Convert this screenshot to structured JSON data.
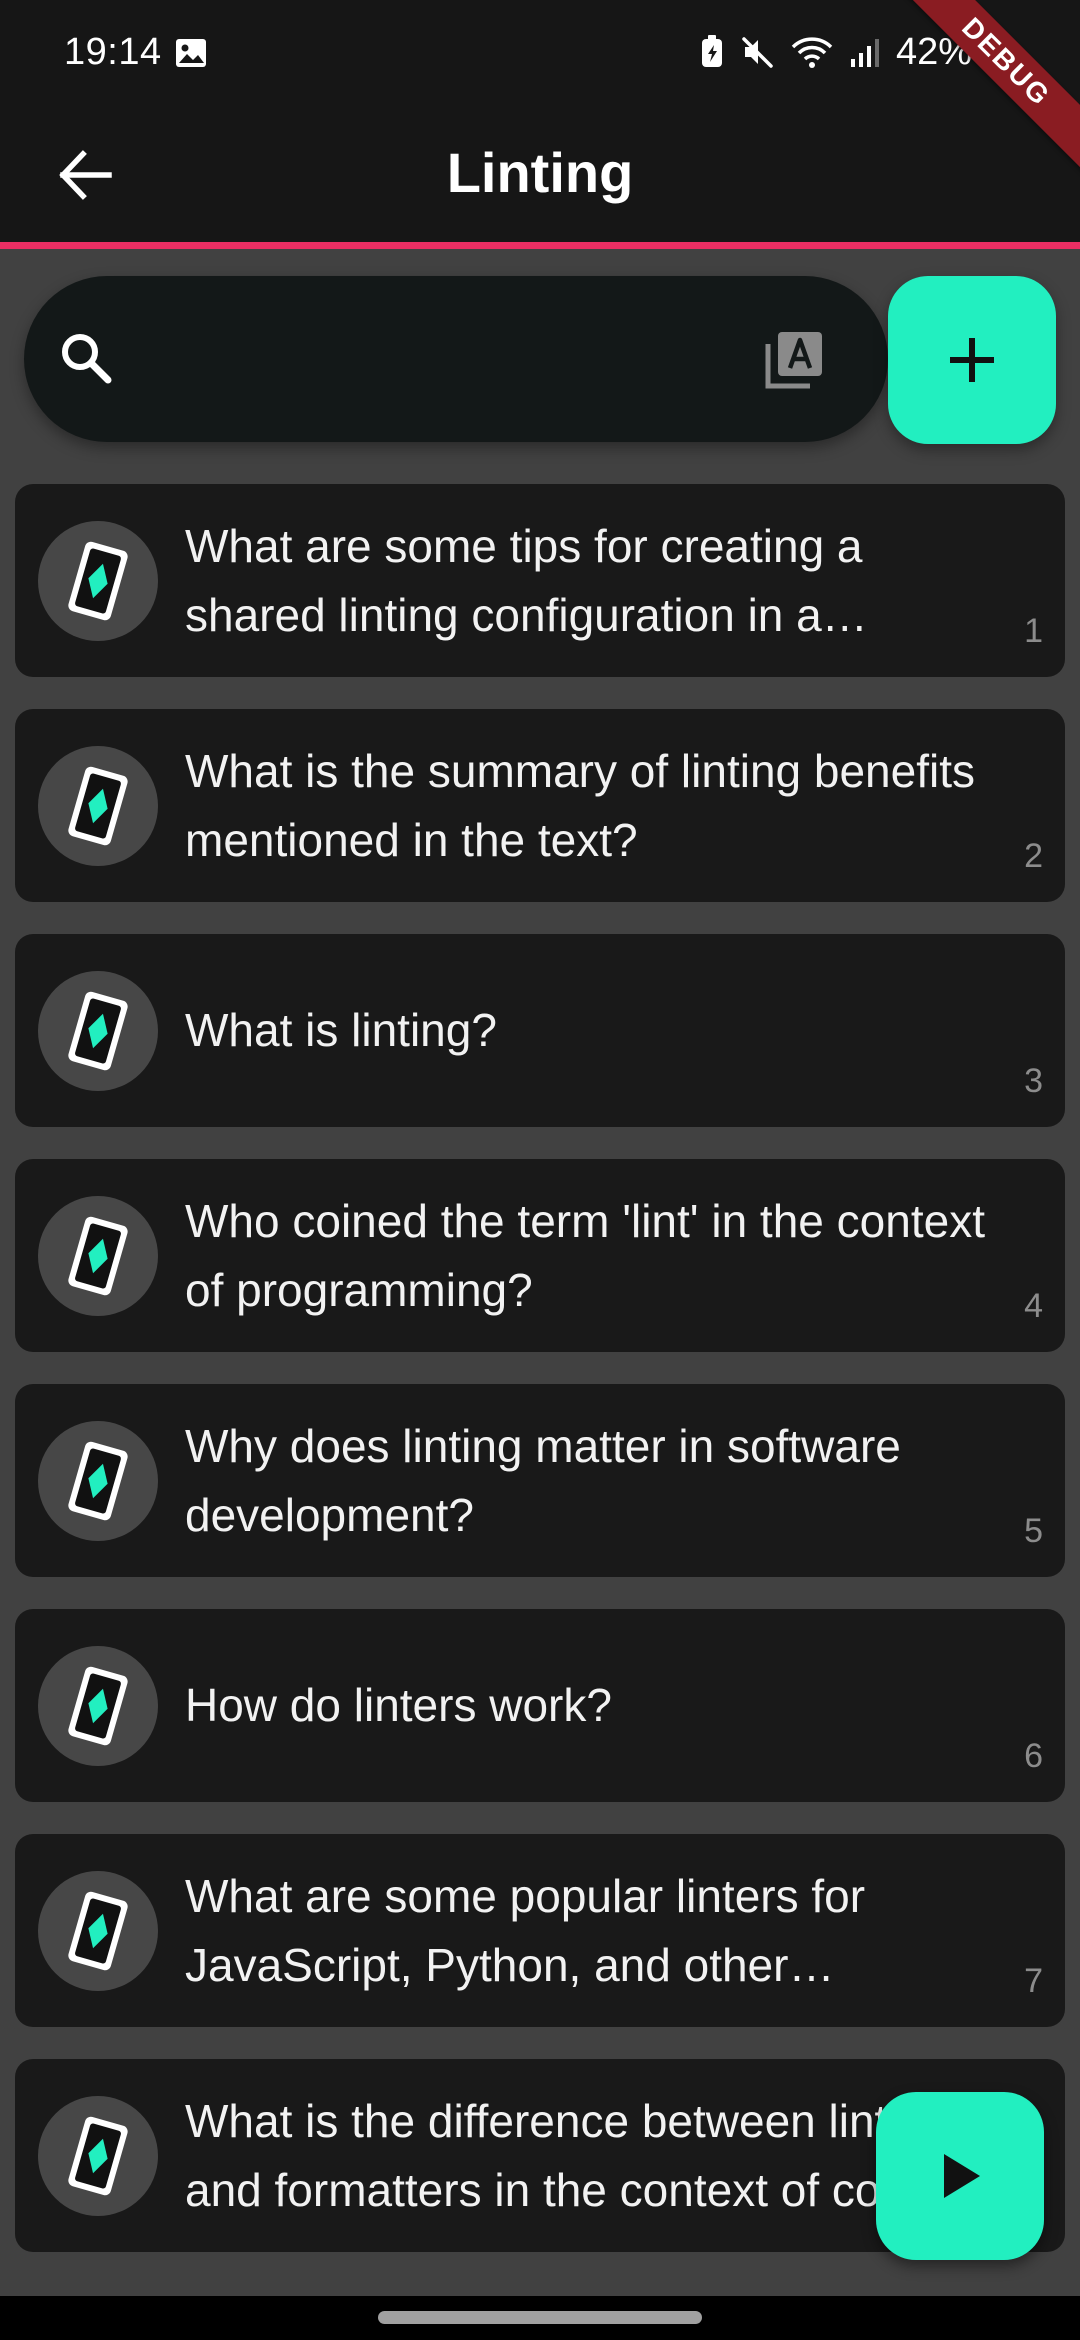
{
  "status_bar": {
    "time": "19:14",
    "battery": "42%",
    "icons": [
      "gallery-icon",
      "battery-saver-icon",
      "mute-icon",
      "wifi-icon",
      "signal-icon",
      "battery-icon"
    ]
  },
  "debug_banner": "DEBUG",
  "app_bar": {
    "title": "Linting",
    "back_icon": "arrow-back-icon",
    "accent_color": "#ea2e63"
  },
  "search": {
    "value": "",
    "placeholder": "",
    "icon": "search-icon",
    "font_size_icon": "font-size-icon"
  },
  "add_button": {
    "icon": "plus-icon",
    "color": "#22efc0"
  },
  "cards": [
    {
      "text": "What are some tips for creating a shared linting configuration in a project?",
      "index": "1"
    },
    {
      "text": "What is the summary of linting benefits mentioned in the text?",
      "index": "2"
    },
    {
      "text": "What is linting?",
      "index": "3"
    },
    {
      "text": "Who coined the term 'lint' in the context of programming?",
      "index": "4"
    },
    {
      "text": "Why does linting matter in software development?",
      "index": "5"
    },
    {
      "text": "How do linters work?",
      "index": "6"
    },
    {
      "text": "What are some popular linters for JavaScript, Python, and other languages?",
      "index": "7"
    },
    {
      "text": "What is the difference between linters and formatters in the context of code?",
      "index": ""
    }
  ],
  "card_icon": "flashcard-icon",
  "play_button": {
    "icon": "play-icon",
    "color": "#22efc0"
  }
}
